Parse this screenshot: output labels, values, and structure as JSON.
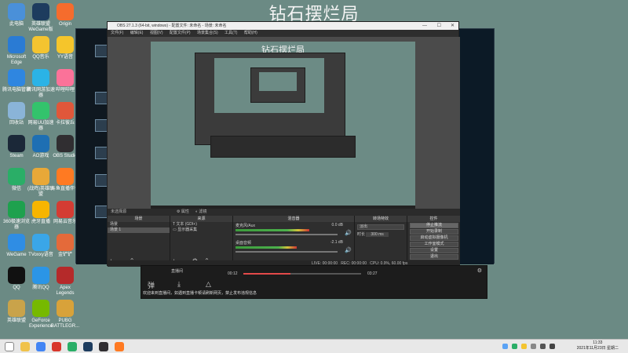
{
  "desktop": {
    "title": "钻石摆烂局",
    "icons": [
      {
        "label": "此电脑",
        "icon": "computer-icon",
        "color": "#4a90d9"
      },
      {
        "label": "英雄联盟WeGame版",
        "icon": "lol-icon",
        "color": "#1d3c5e"
      },
      {
        "label": "Origin",
        "icon": "origin-icon",
        "color": "#f56c2d"
      },
      {
        "label": "Microsoft Edge",
        "icon": "edge-icon",
        "color": "#2a7bd4"
      },
      {
        "label": "QQ音乐",
        "icon": "qqmusic-icon",
        "color": "#f4c430"
      },
      {
        "label": "YY语音",
        "icon": "yy-icon",
        "color": "#f5c52b"
      },
      {
        "label": "腾讯电脑管家",
        "icon": "pcmanager-icon",
        "color": "#2f86e0"
      },
      {
        "label": "腾讯网游加速器",
        "icon": "accelerator-icon",
        "color": "#2bb3e6"
      },
      {
        "label": "哔哩哔哩",
        "icon": "bilibili-icon",
        "color": "#fb7299"
      },
      {
        "label": "回收站",
        "icon": "recycle-bin-icon",
        "color": "#8ab4d8"
      },
      {
        "label": "网易UU加速器",
        "icon": "uu-icon",
        "color": "#33c36c"
      },
      {
        "label": "卡拉彼丘",
        "icon": "game-icon",
        "color": "#e0573a"
      },
      {
        "label": "Steam",
        "icon": "steam-icon",
        "color": "#1b2838"
      },
      {
        "label": "AO游戏",
        "icon": "ao-icon",
        "color": "#1e6fb3"
      },
      {
        "label": "OBS Studio",
        "icon": "obs-icon",
        "color": "#302e31"
      },
      {
        "label": "微信",
        "icon": "wechat-icon",
        "color": "#2aae67"
      },
      {
        "label": "(战鸡)英雄联盟",
        "icon": "league-icon",
        "color": "#e8a838"
      },
      {
        "label": "斗鱼直播伴侣",
        "icon": "douyu-icon",
        "color": "#ff7a22"
      },
      {
        "label": "360极速浏览器",
        "icon": "browser-icon",
        "color": "#1ea14e"
      },
      {
        "label": "虎牙直播",
        "icon": "huya-icon",
        "color": "#f7b500"
      },
      {
        "label": "网易云音乐",
        "icon": "netease-icon",
        "color": "#d43c33"
      },
      {
        "label": "WeGame",
        "icon": "wegame-icon",
        "color": "#2f8de4"
      },
      {
        "label": "TVoxxy语音",
        "icon": "voice-icon",
        "color": "#3aa6e8"
      },
      {
        "label": "金铲铲",
        "icon": "tft-icon",
        "color": "#e46a3a"
      },
      {
        "label": "QQ",
        "icon": "qq-icon",
        "color": "#111111"
      },
      {
        "label": "腾讯QQ",
        "icon": "qq-alt-icon",
        "color": "#2b95e6"
      },
      {
        "label": "Apex Legends",
        "icon": "apex-icon",
        "color": "#b52a2a"
      },
      {
        "label": "英雄联盟",
        "icon": "lol-client-icon",
        "color": "#c9a34a"
      },
      {
        "label": "GeForce Experience",
        "icon": "nvidia-icon",
        "color": "#76b900"
      },
      {
        "label": "PUBG BATTLEGR...",
        "icon": "pubg-icon",
        "color": "#d8a23a"
      }
    ]
  },
  "obs": {
    "title": "OBS 27.1.3 (64-bit, windows) - 配置文件: 未命名 - 场景: 未命名",
    "menu": [
      "文件(F)",
      "编辑(E)",
      "视图(V)",
      "配置文件(P)",
      "场景集合(S)",
      "工具(T)",
      "帮助(H)"
    ],
    "canvas_title": "钻石摆烂局",
    "toolbar": {
      "properties": "属性",
      "filters": "滤镜",
      "no_source": "未选择源"
    },
    "scenes": {
      "header": "场景",
      "items": [
        "场景",
        "场景 1"
      ]
    },
    "sources": {
      "header": "来源",
      "items": [
        "文本 (GDI+)",
        "显示器采集"
      ]
    },
    "mixer": {
      "header": "混音器",
      "tracks": [
        {
          "name": "麦克风/Aux",
          "db": "0.0 dB",
          "level": 0.72
        },
        {
          "name": "桌面音频",
          "db": "-2.1 dB",
          "level": 0.6
        }
      ]
    },
    "transitions": {
      "header": "转场特效",
      "type": "淡出",
      "duration_label": "时长",
      "duration": "300 ms"
    },
    "controls": {
      "header": "控件",
      "buttons": [
        "停止推流",
        "开始录制",
        "启动虚拟摄像机",
        "工作室模式",
        "设置",
        "退出"
      ]
    },
    "status": {
      "live": "LIVE: 00:00:00",
      "rec": "REC: 00:00:00",
      "cpu": "CPU: 0.9%, 60.00 fps"
    }
  },
  "player": {
    "title": "直播间",
    "current_time": "00:12",
    "total_time": "03:27",
    "progress": 0.4,
    "notice": "欢迎来到直播间，如遇到直播卡顿请刷新网页，禁止发布违规信息"
  },
  "taskbar": {
    "time": "11:33",
    "date": "2021年11月23日 星期二",
    "apps": [
      {
        "icon": "start-icon",
        "color": "#ffffff"
      },
      {
        "icon": "folder-icon",
        "color": "#f0c24a"
      },
      {
        "icon": "chrome-icon",
        "color": "#4285f4"
      },
      {
        "icon": "game-launcher-icon",
        "color": "#d8362b"
      },
      {
        "icon": "wechat-taskbar-icon",
        "color": "#2aae67"
      },
      {
        "icon": "league-taskbar-icon",
        "color": "#1d3c5e"
      },
      {
        "icon": "obs-taskbar-icon",
        "color": "#302e31"
      },
      {
        "icon": "douyu-taskbar-icon",
        "color": "#ff7a22"
      }
    ]
  }
}
